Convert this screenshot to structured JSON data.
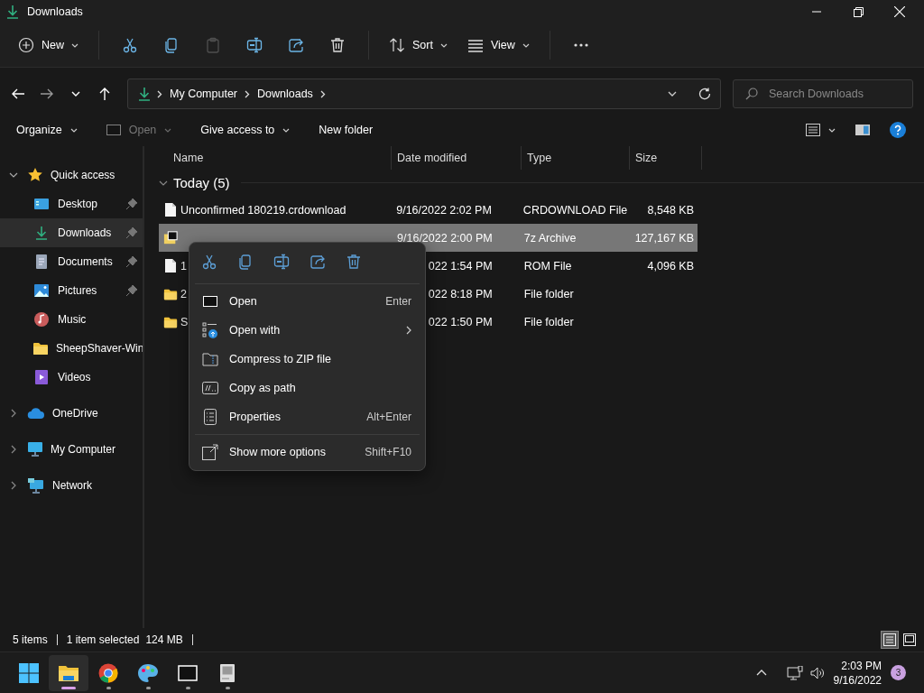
{
  "window": {
    "title": "Downloads"
  },
  "toolbar": {
    "items": [
      {
        "kind": "new",
        "label": "New",
        "disabled": false
      },
      {
        "kind": "cut",
        "disabled": false
      },
      {
        "kind": "copy",
        "disabled": false
      },
      {
        "kind": "paste",
        "disabled": true
      },
      {
        "kind": "rename",
        "disabled": false
      },
      {
        "kind": "share",
        "disabled": false
      },
      {
        "kind": "delete",
        "disabled": false
      },
      {
        "kind": "sort",
        "label": "Sort",
        "disabled": false
      },
      {
        "kind": "view",
        "label": "View",
        "disabled": false
      },
      {
        "kind": "more",
        "disabled": false
      }
    ]
  },
  "address_bar": {
    "path": [
      "My Computer",
      "Downloads"
    ]
  },
  "search": {
    "placeholder": "Search Downloads"
  },
  "command_bar": {
    "items": [
      {
        "kind": "menu",
        "label": "Organize",
        "disabled": false
      },
      {
        "kind": "open",
        "label": "Open",
        "disabled": true
      },
      {
        "kind": "menu",
        "label": "Give access to",
        "disabled": false
      },
      {
        "kind": "plain",
        "label": "New folder",
        "disabled": false
      }
    ]
  },
  "sidebar": {
    "items": [
      {
        "kind": "star",
        "label": "Quick access",
        "expanded": true,
        "selected": false,
        "children": [
          {
            "kind": "desktop",
            "label": "Desktop",
            "pinned": true,
            "selected": false
          },
          {
            "kind": "download",
            "label": "Downloads",
            "pinned": true,
            "selected": true
          },
          {
            "kind": "documents",
            "label": "Documents",
            "pinned": true,
            "selected": false
          },
          {
            "kind": "pictures",
            "label": "Pictures",
            "pinned": true,
            "selected": false
          },
          {
            "kind": "music",
            "label": "Music",
            "pinned": false,
            "selected": false
          },
          {
            "kind": "folder",
            "label": "SheepShaver-Win",
            "pinned": false,
            "selected": false
          },
          {
            "kind": "videos",
            "label": "Videos",
            "pinned": false,
            "selected": false
          }
        ]
      },
      {
        "kind": "cloud",
        "label": "OneDrive",
        "expanded": false,
        "selected": false
      },
      {
        "kind": "computer",
        "label": "My Computer",
        "expanded": false,
        "selected": false
      },
      {
        "kind": "network",
        "label": "Network",
        "expanded": false,
        "selected": false
      }
    ]
  },
  "file_list": {
    "columns": [
      "Name",
      "Date modified",
      "Type",
      "Size"
    ],
    "group": {
      "label": "Today (5)",
      "expanded": true
    },
    "rows": [
      {
        "kind": "file",
        "name": "Unconfirmed 180219.crdownload",
        "date": "9/16/2022 2:02 PM",
        "type": "CRDOWNLOAD File",
        "size": "8,548 KB",
        "selected": false
      },
      {
        "kind": "archive",
        "date": "9/16/2022 2:00 PM",
        "type": "7z Archive",
        "size": "127,167 KB",
        "selected": true
      },
      {
        "kind": "file",
        "name": "1",
        "date": "022 1:54 PM",
        "type": "ROM File",
        "size": "4,096 KB",
        "selected": false
      },
      {
        "kind": "folder",
        "name": "2",
        "date": "022 8:18 PM",
        "type": "File folder",
        "selected": false
      },
      {
        "kind": "folder",
        "name": "S",
        "date": "022 1:50 PM",
        "type": "File folder",
        "selected": false
      }
    ]
  },
  "context_menu": {
    "actions": [
      {
        "kind": "cut"
      },
      {
        "kind": "copy"
      },
      {
        "kind": "rename"
      },
      {
        "kind": "share"
      },
      {
        "kind": "delete"
      }
    ],
    "items": [
      {
        "kind": "open",
        "label": "Open",
        "shortcut": "Enter",
        "submenu": false
      },
      {
        "kind": "open-with",
        "label": "Open with",
        "submenu": true
      },
      {
        "kind": "zip",
        "label": "Compress to ZIP file",
        "submenu": false
      },
      {
        "kind": "path",
        "label": "Copy as path",
        "submenu": false
      },
      {
        "kind": "properties",
        "label": "Properties",
        "shortcut": "Alt+Enter",
        "submenu": false
      },
      {
        "kind": "more",
        "label": "Show more options",
        "shortcut": "Shift+F10",
        "submenu": false
      }
    ]
  },
  "status_bar": {
    "count": "5 items",
    "selection": "1 item selected",
    "size": "124 MB",
    "views": [
      {
        "kind": "details",
        "selected": true
      },
      {
        "kind": "tiles",
        "selected": false
      }
    ]
  },
  "taskbar": {
    "apps": [
      {
        "kind": "start",
        "running": false,
        "active": false
      },
      {
        "kind": "explorer",
        "running": true,
        "active": true
      },
      {
        "kind": "browser",
        "running": true,
        "active": false
      },
      {
        "kind": "paint",
        "running": true,
        "active": false
      },
      {
        "kind": "archiver",
        "running": true,
        "active": false
      },
      {
        "kind": "mac",
        "running": true,
        "active": false
      }
    ],
    "time": "2:03 PM",
    "date": "9/16/2022",
    "notifications": "3"
  }
}
